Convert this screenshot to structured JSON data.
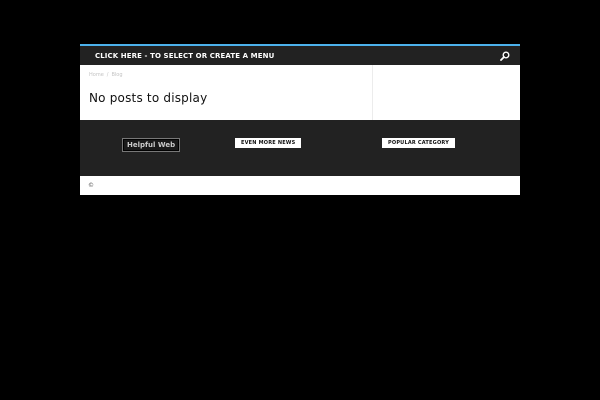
{
  "header": {
    "menu_label": "CLICK HERE - TO SELECT OR CREATE A MENU",
    "search_icon": "search-icon"
  },
  "breadcrumb": {
    "items": [
      "Home",
      "Blog"
    ],
    "separator": "/"
  },
  "main": {
    "title": "No posts to display"
  },
  "footer": {
    "logo_text": "Helpful Web",
    "blocks": [
      {
        "title": "EVEN MORE NEWS"
      },
      {
        "title": "POPULAR CATEGORY"
      }
    ]
  },
  "subfooter": {
    "copyright": "©"
  },
  "colors": {
    "accent": "#4db2ec",
    "background": "#000000",
    "bar": "#222222"
  }
}
